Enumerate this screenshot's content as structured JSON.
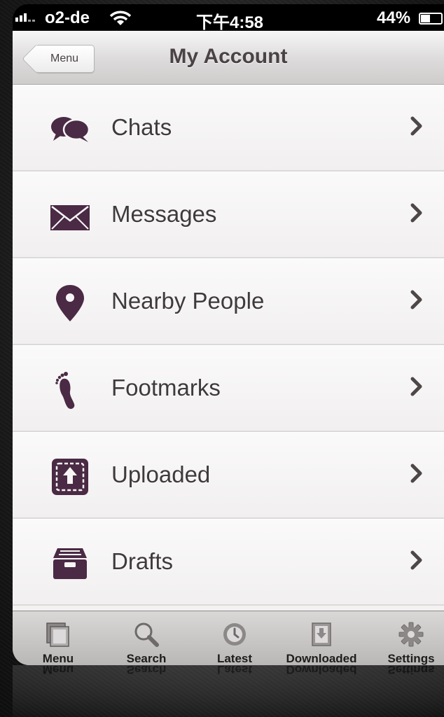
{
  "status_bar": {
    "carrier": "o2-de",
    "time": "下午4:58",
    "battery": "44%"
  },
  "nav": {
    "back_label": "Menu",
    "title": "My Account"
  },
  "items": [
    {
      "label": "Chats",
      "icon": "chat-bubbles-icon"
    },
    {
      "label": "Messages",
      "icon": "envelope-icon"
    },
    {
      "label": "Nearby People",
      "icon": "location-pin-icon"
    },
    {
      "label": "Footmarks",
      "icon": "footprint-icon"
    },
    {
      "label": "Uploaded",
      "icon": "upload-icon"
    },
    {
      "label": "Drafts",
      "icon": "drafts-tray-icon"
    }
  ],
  "tabs": [
    {
      "label": "Menu",
      "icon": "menu-pages-icon"
    },
    {
      "label": "Search",
      "icon": "magnifier-icon"
    },
    {
      "label": "Latest",
      "icon": "clock-icon"
    },
    {
      "label": "Downloaded",
      "icon": "download-icon"
    },
    {
      "label": "Settings",
      "icon": "gear-icon"
    }
  ],
  "colors": {
    "icon_purple": "#4a2a44",
    "text": "#3f3a3b"
  }
}
